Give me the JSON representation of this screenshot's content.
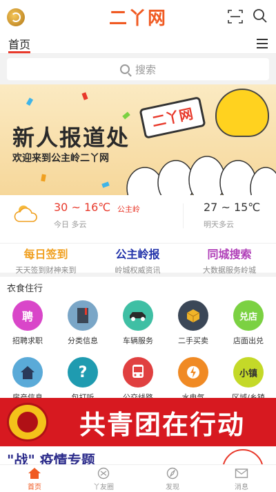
{
  "header": {
    "brand": "二丫网"
  },
  "tabs": {
    "home": "首页"
  },
  "search": {
    "placeholder": "搜索"
  },
  "banner": {
    "title": "新人报道处",
    "subtitle": "欢迎来到公主岭二丫网",
    "sign": "二丫网"
  },
  "weather": {
    "today_temp": "30 ~ 16℃",
    "place": "公主岭",
    "today_desc": "今日 多云",
    "tomorrow_temp": "27 ~ 15℃",
    "tomorrow_desc": "明天多云"
  },
  "quick": [
    {
      "title": "每日签到",
      "sub": "天天签到财神来到",
      "color": "#f0a020"
    },
    {
      "title": "公主岭报",
      "sub": "岭城权威资讯",
      "color": "#2233aa"
    },
    {
      "title": "同城搜索",
      "sub": "大数据服务岭城",
      "color": "#b03fb8"
    }
  ],
  "section": {
    "title": "衣食住行"
  },
  "services": [
    {
      "label": "招聘求职",
      "icon": "recruit-icon",
      "glyph": "聘",
      "bg": "#d946c9"
    },
    {
      "label": "分类信息",
      "icon": "book-icon",
      "glyph": "",
      "bg": "#7aa6c7"
    },
    {
      "label": "车辆服务",
      "icon": "car-icon",
      "glyph": "",
      "bg": "#3fbfa4"
    },
    {
      "label": "二手买卖",
      "icon": "box-icon",
      "glyph": "",
      "bg": "#3b4757"
    },
    {
      "label": "店面出兑",
      "icon": "shop-icon",
      "glyph": "兑店",
      "bg": "#7bd142"
    },
    {
      "label": "房产信息",
      "icon": "house-icon",
      "glyph": "",
      "bg": "#5aaad8"
    },
    {
      "label": "包打听",
      "icon": "question-icon",
      "glyph": "?",
      "bg": "#1f9bb0"
    },
    {
      "label": "公交线路",
      "icon": "bus-icon",
      "glyph": "",
      "bg": "#e04040"
    },
    {
      "label": "水电气",
      "icon": "utility-icon",
      "glyph": "",
      "bg": "#f08a24"
    },
    {
      "label": "区域/乡镇",
      "icon": "town-icon",
      "glyph": "小镇",
      "bg": "#c4d928"
    }
  ],
  "promo": {
    "youth": "共青团在行动",
    "epidemic": "\"战\" 疫情专题"
  },
  "nav": [
    {
      "label": "首页",
      "active": true
    },
    {
      "label": "丫友圈"
    },
    {
      "label": "发现"
    },
    {
      "label": "消息"
    }
  ]
}
